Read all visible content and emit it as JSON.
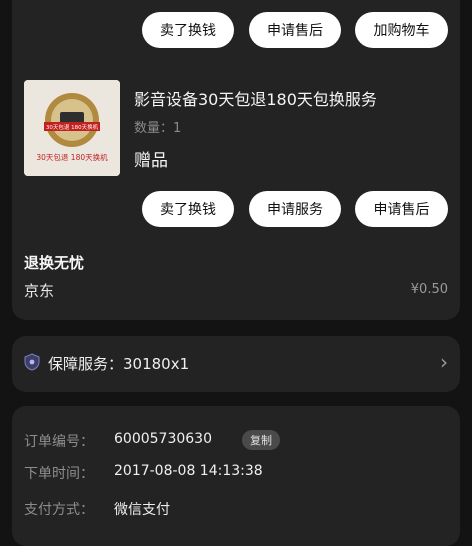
{
  "top_actions": [
    "卖了换钱",
    "申请售后",
    "加购物车"
  ],
  "gift_item": {
    "title": "影音设备30天包退180天包换服务",
    "quantity": "数量：1",
    "tag": "赠品",
    "thumb_text": "30天包退 180天换机",
    "badge_text": "30天包退 180天换机"
  },
  "gift_actions": [
    "卖了换钱",
    "申请服务",
    "申请售后"
  ],
  "return": {
    "title": "退换无忧",
    "shop": "京东",
    "price": "¥0.50"
  },
  "service": {
    "label": "保障服务：30180x1",
    "chevron": "›"
  },
  "order": {
    "number_label": "订单编号：",
    "number_value": "60005730630",
    "copy_label": "复制",
    "time_label": "下单时间：",
    "time_value": "2017-08-08 14:13:38",
    "pay_label": "支付方式：",
    "pay_value": "微信支付"
  },
  "colors": {
    "background": "#131313",
    "card": "#232323",
    "pill": "#ffffff",
    "badge_red": "#c21f1f",
    "badge_gold": "#b08a3e"
  }
}
